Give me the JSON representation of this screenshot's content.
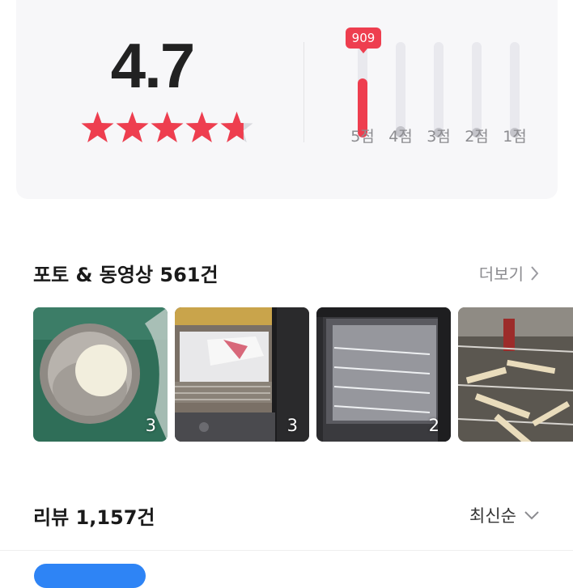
{
  "rating": {
    "score": "4.7",
    "stars_value": 4.7,
    "stars_max": 5,
    "distribution": [
      {
        "label": "5점",
        "fraction": 0.62,
        "active": true,
        "count_badge": "909"
      },
      {
        "label": "4점",
        "fraction": 0.12,
        "active": false
      },
      {
        "label": "3점",
        "fraction": 0.04,
        "active": false
      },
      {
        "label": "2점",
        "fraction": 0.04,
        "active": false
      },
      {
        "label": "1점",
        "fraction": 0.04,
        "active": false
      }
    ]
  },
  "photos": {
    "title": "포토 & 동영상 561건",
    "more_label": "더보기",
    "items": [
      {
        "count": "3"
      },
      {
        "count": "3"
      },
      {
        "count": "2"
      },
      {
        "count": ""
      }
    ]
  },
  "reviews": {
    "title": "리뷰 1,157건",
    "sort_label": "최신순"
  },
  "colors": {
    "accent": "#ee3e4f",
    "blue": "#2e84f5"
  }
}
